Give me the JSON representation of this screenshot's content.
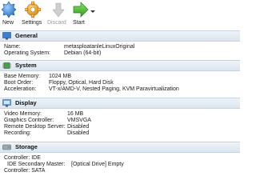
{
  "toolbar": {
    "new_label": "New",
    "settings_label": "Settings",
    "discard_label": "Discard",
    "start_label": "Start"
  },
  "sections": {
    "general": {
      "title": "General",
      "rows": [
        {
          "label": "Name:",
          "value": "metasploatanleLinuxOriginal"
        },
        {
          "label": "Operating System:",
          "value": "Debian (64-bit)"
        }
      ]
    },
    "system": {
      "title": "System",
      "rows": [
        {
          "label": "Base Memory:",
          "value": "1024 MB"
        },
        {
          "label": "Boot Order:",
          "value": "Floppy, Optical, Hard Disk"
        },
        {
          "label": "Acceleration:",
          "value": "VT-x/AMD-V, Nested Paging, KVM Paravirtualization"
        }
      ]
    },
    "display": {
      "title": "Display",
      "rows": [
        {
          "label": "Video Memory:",
          "value": "16 MB"
        },
        {
          "label": "Graphics Controller:",
          "value": "VMSVGA"
        },
        {
          "label": "Remote Desktop Server:",
          "value": "Disabled"
        },
        {
          "label": "Recording:",
          "value": "Disabled"
        }
      ]
    },
    "storage": {
      "title": "Storage",
      "rows": [
        {
          "label": "Controller: IDE",
          "value": ""
        },
        {
          "label": "IDE Secondary Master:",
          "value": "[Optical Drive] Empty"
        },
        {
          "label": "Controller: SATA",
          "value": ""
        }
      ]
    }
  },
  "colors": {
    "header_bg": "#dbe5ef",
    "start_green": "#3fae2a",
    "new_blue": "#4a8fd8",
    "settings_orange": "#f0a020"
  }
}
